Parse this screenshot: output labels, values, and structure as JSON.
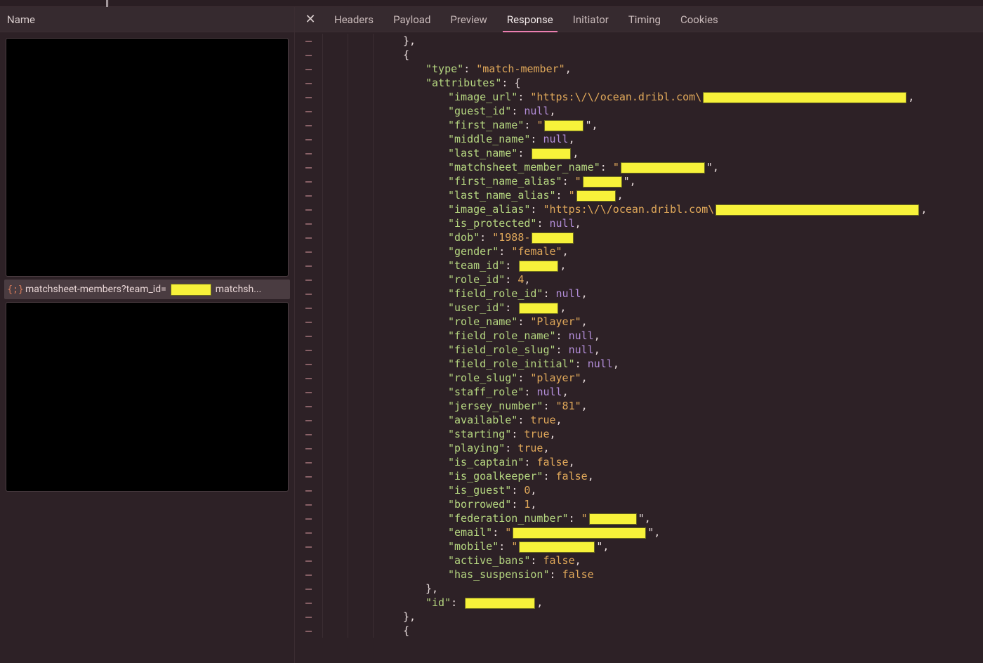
{
  "left": {
    "header": "Name",
    "request_prefix": "matchsheet-members?team_id=",
    "request_suffix_cutoff": "matchsh..."
  },
  "tabs": {
    "close_glyph": "✕",
    "items": [
      "Headers",
      "Payload",
      "Preview",
      "Response",
      "Initiator",
      "Timing",
      "Cookies"
    ],
    "active_index": 3
  },
  "json": {
    "type_key": "\"type\"",
    "type_val": "\"match-member\"",
    "attributes_key": "\"attributes\"",
    "id_key": "\"id\"",
    "attrs": [
      {
        "k": "\"image_url\"",
        "v": "\"https:\\/\\/ocean.dribl.com\\",
        "redact_w": 290,
        "tail": ",",
        "vtype": "str"
      },
      {
        "k": "\"guest_id\"",
        "v": "null",
        "vtype": "null",
        "tail": ","
      },
      {
        "k": "\"first_name\"",
        "v": "\"",
        "redact_w": 56,
        "tail": "\",",
        "vtype": "str"
      },
      {
        "k": "\"middle_name\"",
        "v": "null",
        "vtype": "null",
        "tail": ","
      },
      {
        "k": "\"last_name\"",
        "redact_w": 56,
        "vtype": "redact-only",
        "tail": ","
      },
      {
        "k": "\"matchsheet_member_name\"",
        "v": "\"",
        "redact_w": 120,
        "tail": "\",",
        "vtype": "str"
      },
      {
        "k": "\"first_name_alias\"",
        "v": "\"",
        "redact_w": 56,
        "tail": "\",",
        "vtype": "str"
      },
      {
        "k": "\"last_name_alias\"",
        "v": "\"",
        "redact_w": 56,
        "tail": ",",
        "vtype": "str"
      },
      {
        "k": "\"image_alias\"",
        "v": "\"https:\\/\\/ocean.dribl.com\\",
        "redact_w": 290,
        "tail": ",",
        "vtype": "str"
      },
      {
        "k": "\"is_protected\"",
        "v": "null",
        "vtype": "null",
        "tail": ","
      },
      {
        "k": "\"dob\"",
        "v": "\"1988-",
        "redact_w": 60,
        "tail": "",
        "vtype": "str"
      },
      {
        "k": "\"gender\"",
        "v": "\"female\"",
        "vtype": "str",
        "tail": ","
      },
      {
        "k": "\"team_id\"",
        "redact_w": 56,
        "vtype": "redact-only",
        "tail": ","
      },
      {
        "k": "\"role_id\"",
        "v": "4",
        "vtype": "num",
        "tail": ","
      },
      {
        "k": "\"field_role_id\"",
        "v": "null",
        "vtype": "null",
        "tail": ","
      },
      {
        "k": "\"user_id\"",
        "redact_w": 56,
        "vtype": "redact-only",
        "tail": ","
      },
      {
        "k": "\"role_name\"",
        "v": "\"Player\"",
        "vtype": "str",
        "tail": ","
      },
      {
        "k": "\"field_role_name\"",
        "v": "null",
        "vtype": "null",
        "tail": ","
      },
      {
        "k": "\"field_role_slug\"",
        "v": "null",
        "vtype": "null",
        "tail": ","
      },
      {
        "k": "\"field_role_initial\"",
        "v": "null",
        "vtype": "null",
        "tail": ","
      },
      {
        "k": "\"role_slug\"",
        "v": "\"player\"",
        "vtype": "str",
        "tail": ","
      },
      {
        "k": "\"staff_role\"",
        "v": "null",
        "vtype": "null",
        "tail": ","
      },
      {
        "k": "\"jersey_number\"",
        "v": "\"81\"",
        "vtype": "str",
        "tail": ","
      },
      {
        "k": "\"available\"",
        "v": "true",
        "vtype": "bool",
        "tail": ","
      },
      {
        "k": "\"starting\"",
        "v": "true",
        "vtype": "bool",
        "tail": ","
      },
      {
        "k": "\"playing\"",
        "v": "true",
        "vtype": "bool",
        "tail": ","
      },
      {
        "k": "\"is_captain\"",
        "v": "false",
        "vtype": "bool",
        "tail": ","
      },
      {
        "k": "\"is_goalkeeper\"",
        "v": "false",
        "vtype": "bool",
        "tail": ","
      },
      {
        "k": "\"is_guest\"",
        "v": "0",
        "vtype": "num",
        "tail": ","
      },
      {
        "k": "\"borrowed\"",
        "v": "1",
        "vtype": "num",
        "tail": ","
      },
      {
        "k": "\"federation_number\"",
        "v": "\"",
        "redact_w": 68,
        "tail": "\",",
        "vtype": "str"
      },
      {
        "k": "\"email\"",
        "v": "\"",
        "redact_w": 190,
        "tail": "\",",
        "vtype": "str"
      },
      {
        "k": "\"mobile\"",
        "v": "\"",
        "redact_w": 108,
        "tail": "\",",
        "vtype": "str"
      },
      {
        "k": "\"active_bans\"",
        "v": "false",
        "vtype": "bool",
        "tail": ","
      },
      {
        "k": "\"has_suspension\"",
        "v": "false",
        "vtype": "bool",
        "tail": ""
      }
    ],
    "id_redact_w": 100,
    "gutter_dash": "–"
  }
}
